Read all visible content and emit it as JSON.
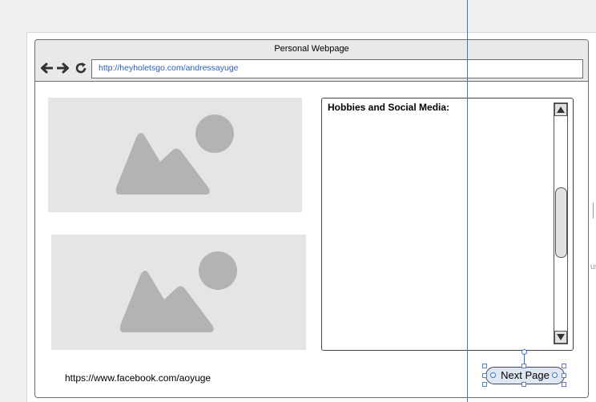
{
  "browser": {
    "title": "Personal Webpage",
    "url": "http://heyholetsgo.com/andressayuge"
  },
  "nav_icons": [
    "back-arrow-icon",
    "forward-arrow-icon",
    "reload-icon"
  ],
  "panel": {
    "title": "Hobbies and Social Media:"
  },
  "link_text": "https://www.facebook.com/aoyuge",
  "next_button": {
    "label": "Next Page"
  },
  "edge_text": "us",
  "colors": {
    "accent": "#2f7fc1",
    "placeholder": "#e5e5e5",
    "placeholder_shape": "#b3b3b3",
    "url_text": "#2a5db0"
  }
}
